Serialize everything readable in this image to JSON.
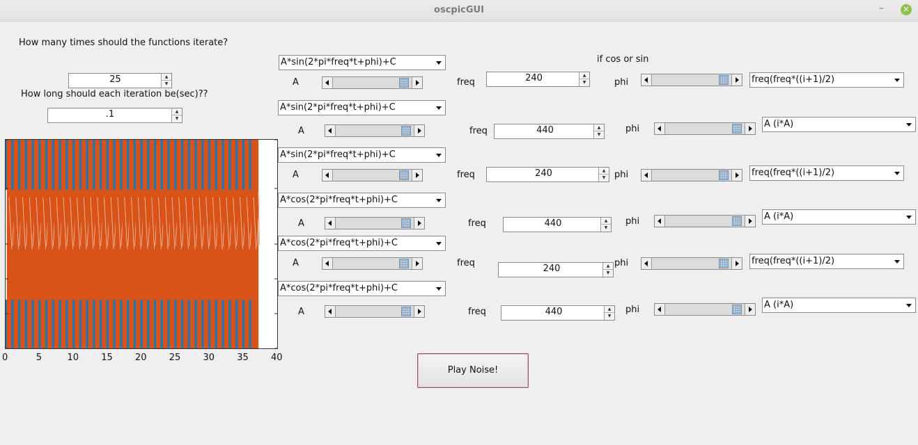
{
  "window": {
    "title": "oscpicGUI",
    "minimize_glyph": "–",
    "close_glyph": "✕"
  },
  "controls": {
    "iterations_prompt": "How many times should the functions iterate?",
    "iterations_value": "25",
    "duration_prompt": "How long should each iteration be(sec)??",
    "duration_value": ".1",
    "cos_sin_label": "if cos or sin",
    "play_label": "Play Noise!"
  },
  "rows": [
    {
      "func": "A*sin(2*pi*freq*t+phi)+C",
      "a_label": "A",
      "a_level": 0.95,
      "freq_label": "freq",
      "freq_value": "240",
      "phi_label": "phi",
      "phi_level": 0.95,
      "mode": "freq(freq*((i+1)/2)"
    },
    {
      "func": "A*sin(2*pi*freq*t+phi)+C",
      "a_label": "A",
      "a_level": 0.95,
      "freq_label": "freq",
      "freq_value": "440",
      "phi_label": "phi",
      "phi_level": 0.95,
      "mode": "A (i*A)"
    },
    {
      "func": "A*sin(2*pi*freq*t+phi)+C",
      "a_label": "A",
      "a_level": 0.95,
      "freq_label": "freq",
      "freq_value": "240",
      "phi_label": "phi",
      "phi_level": 0.95,
      "mode": "freq(freq*((i+1)/2)"
    },
    {
      "func": "A*cos(2*pi*freq*t+phi)+C",
      "a_label": "A",
      "a_level": 0.95,
      "freq_label": "freq",
      "freq_value": "440",
      "phi_label": "phi",
      "phi_level": 0.95,
      "mode": "A (i*A)"
    },
    {
      "func": "A*cos(2*pi*freq*t+phi)+C",
      "a_label": "A",
      "a_level": 0.95,
      "freq_label": "freq",
      "freq_value": "240",
      "phi_label": "phi",
      "phi_level": 0.95,
      "mode": "freq(freq*((i+1)/2)"
    },
    {
      "func": "A*cos(2*pi*freq*t+phi)+C",
      "a_label": "A",
      "a_level": 0.95,
      "freq_label": "freq",
      "freq_value": "440",
      "phi_label": "phi",
      "phi_level": 0.95,
      "mode": "A (i*A)"
    }
  ],
  "colors": {
    "series_blue": "#1f77b4",
    "series_orange": "#d95319"
  },
  "chart_data": {
    "type": "line",
    "xlim": [
      0,
      40
    ],
    "xticks": [
      "0",
      "5",
      "10",
      "15",
      "20",
      "25",
      "30",
      "35",
      "40"
    ],
    "cycles": 37,
    "series": [
      {
        "color": "#1f77b4",
        "x_range": [
          0,
          37
        ],
        "y_range": [
          -1,
          1
        ]
      },
      {
        "color": "#d95319",
        "x_range": [
          0,
          37
        ],
        "y_range": [
          -1,
          1
        ]
      }
    ]
  }
}
